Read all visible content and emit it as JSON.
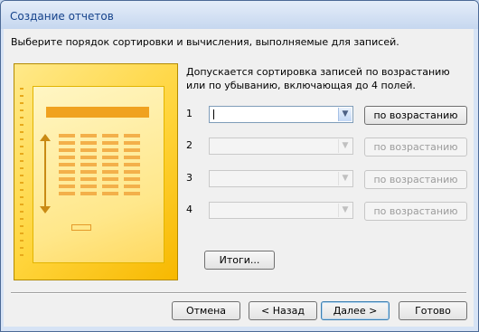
{
  "window": {
    "title": "Создание отчетов"
  },
  "instruction": "Выберите порядок сортировки и вычисления, выполняемые для записей.",
  "description": "Допускается сортировка записей по возрастанию или по убыванию, включающая до 4 полей.",
  "sort_rows": [
    {
      "number": "1",
      "field_value": "",
      "order_label": "по возрастанию",
      "enabled": true
    },
    {
      "number": "2",
      "field_value": "",
      "order_label": "по возрастанию",
      "enabled": false
    },
    {
      "number": "3",
      "field_value": "",
      "order_label": "по возрастанию",
      "enabled": false
    },
    {
      "number": "4",
      "field_value": "",
      "order_label": "по возрастанию",
      "enabled": false
    }
  ],
  "summary_button": "Итоги...",
  "footer": {
    "cancel": "Отмена",
    "back": "< Назад",
    "next": "Далее >",
    "finish": "Готово"
  },
  "colors": {
    "title_text": "#15428b",
    "illustration_accent": "#f0a21f"
  },
  "icons": {
    "dropdown": "chevron-down-icon"
  }
}
